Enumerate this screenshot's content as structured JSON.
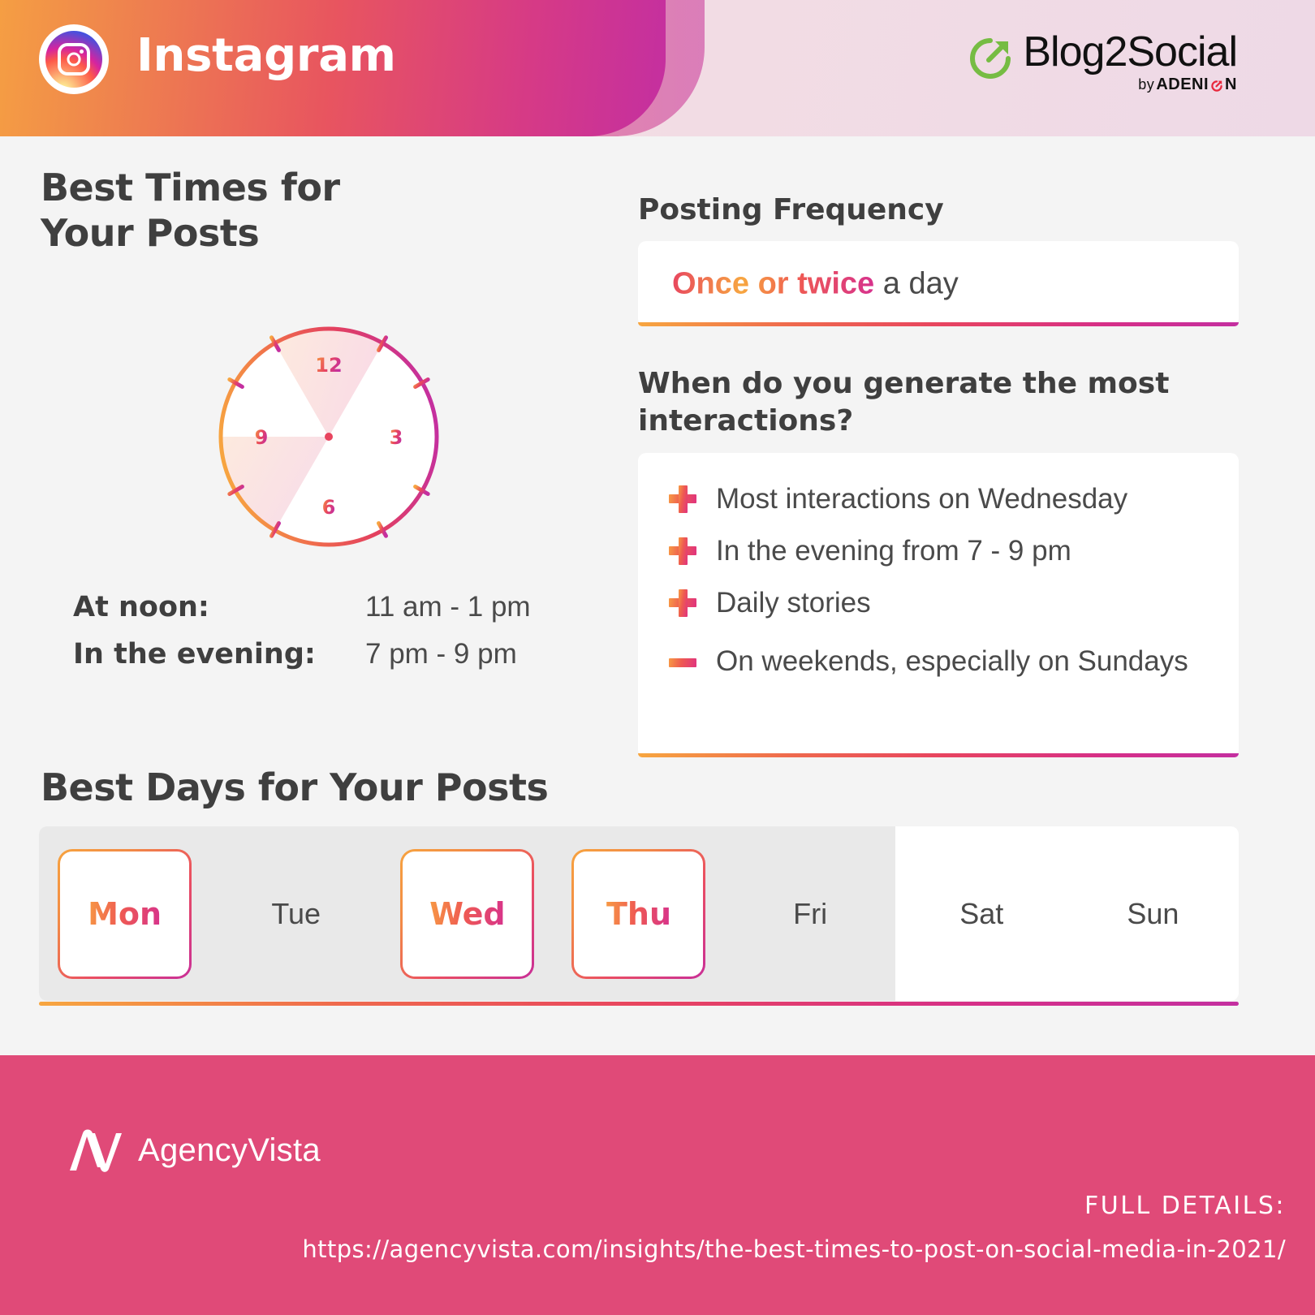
{
  "header": {
    "network": "Instagram",
    "network_icon": "instagram-icon",
    "brand": {
      "name": "Blog2Social",
      "by_prefix": "by",
      "by_name_start": "ADENI",
      "by_name_end": "N",
      "mark_icon": "circular-arrow-icon",
      "mark_color": "#76bc43"
    }
  },
  "best_times": {
    "title": "Best Times for\nYour Posts",
    "clock": {
      "numerals": [
        "12",
        "3",
        "6",
        "9"
      ],
      "highlight_ranges": [
        {
          "label": "At noon",
          "from_hour": 11,
          "to_hour": 13
        },
        {
          "label": "In the evening",
          "from_hour": 19,
          "to_hour": 21
        }
      ]
    },
    "rows": [
      {
        "label": "At noon:",
        "value": "11 am - 1 pm"
      },
      {
        "label": "In the evening:",
        "value": "7 pm - 9 pm"
      }
    ]
  },
  "posting_frequency": {
    "title": "Posting Frequency",
    "value_accent": "Once or twice",
    "value_rest": " a day"
  },
  "interactions": {
    "title": "When do you generate the most interactions?",
    "items": [
      {
        "icon": "plus-icon",
        "sign": "plus",
        "text": "Most interactions on Wednesday"
      },
      {
        "icon": "plus-icon",
        "sign": "plus",
        "text": "In the evening from 7 - 9 pm"
      },
      {
        "icon": "plus-icon",
        "sign": "plus",
        "text": "Daily stories"
      },
      {
        "icon": "minus-icon",
        "sign": "minus",
        "text": "On weekends, especially on Sundays"
      }
    ]
  },
  "best_days": {
    "title": "Best Days for Your Posts",
    "days": [
      {
        "label": "Mon",
        "highlighted": true
      },
      {
        "label": "Tue",
        "highlighted": false
      },
      {
        "label": "Wed",
        "highlighted": true
      },
      {
        "label": "Thu",
        "highlighted": true
      },
      {
        "label": "Fri",
        "highlighted": false
      },
      {
        "label": "Sat",
        "highlighted": false
      },
      {
        "label": "Sun",
        "highlighted": false
      }
    ]
  },
  "footer": {
    "logo_text": "AgencyVista",
    "logo_icon": "agencyvista-logo-icon",
    "full_details_label": "FULL DETAILS:",
    "url": "https://agencyvista.com/insights/the-best-times-to-post-on-social-media-in-2021/",
    "background_color": "#e04a78"
  },
  "colors": {
    "gradient_start": "#f7a640",
    "gradient_mid": "#e8455f",
    "gradient_end": "#c42fa0",
    "page_background": "#f4f4f4",
    "text": "#4a4a4a"
  }
}
